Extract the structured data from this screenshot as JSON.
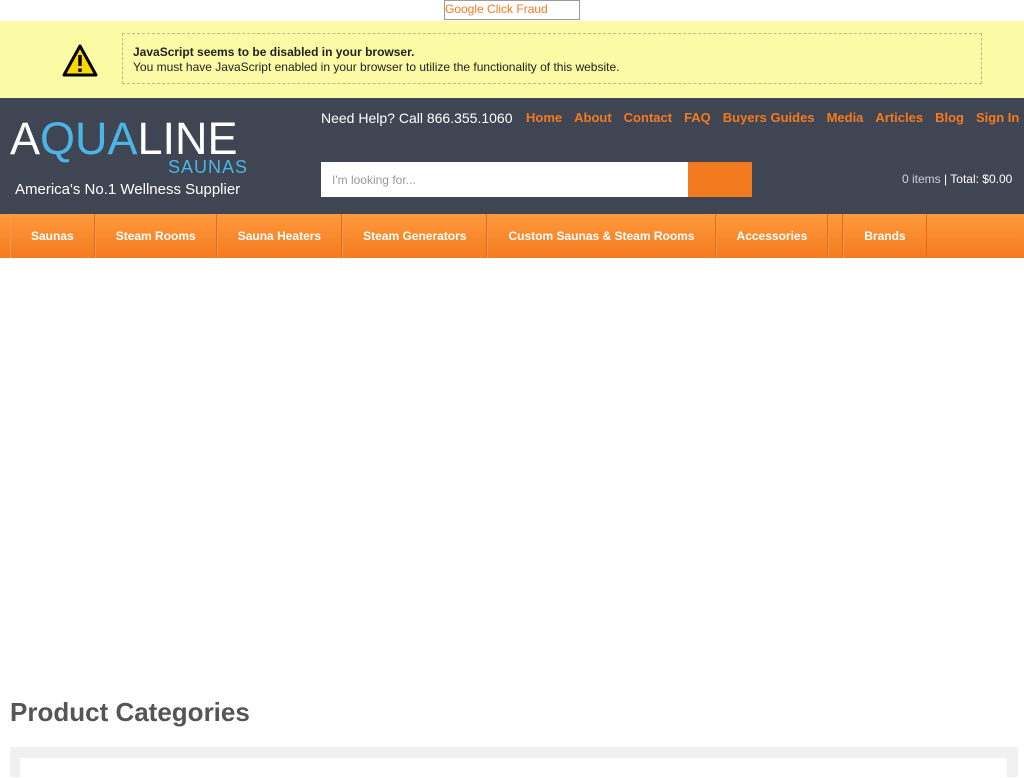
{
  "topbar": {
    "fraud_link": "Google Click Fraud"
  },
  "noscript": {
    "title": "JavaScript seems to be disabled in your browser.",
    "message": "You must have JavaScript enabled in your browser to utilize the functionality of this website."
  },
  "header": {
    "logo": {
      "main_a": "A",
      "main_q": "QUA",
      "main_rest": "LINE",
      "sub": "SAUNAS",
      "tagline": "America's No.1 Wellness Supplier"
    },
    "help_text": "Need Help? Call 866.355.1060",
    "links": [
      "Home",
      "About",
      "Contact",
      "FAQ",
      "Buyers Guides",
      "Media",
      "Articles",
      "Blog",
      "Sign In"
    ],
    "search": {
      "placeholder": "I'm looking for..."
    },
    "cart": {
      "items": "0 items",
      "separator": " | ",
      "total": "Total: $0.00"
    }
  },
  "nav": {
    "items": [
      "Saunas",
      "Steam Rooms",
      "Sauna Heaters",
      "Steam Generators",
      "Custom Saunas & Steam Rooms",
      "Accessories",
      "Brands"
    ]
  },
  "main": {
    "section_title": "Product Categories"
  },
  "colors": {
    "accent": "#f47a20",
    "header_bg": "#404553",
    "logo_blue": "#4bb5e6",
    "warning_bg": "#fbfba6"
  },
  "icons": {
    "warning": "warning-triangle-icon"
  }
}
